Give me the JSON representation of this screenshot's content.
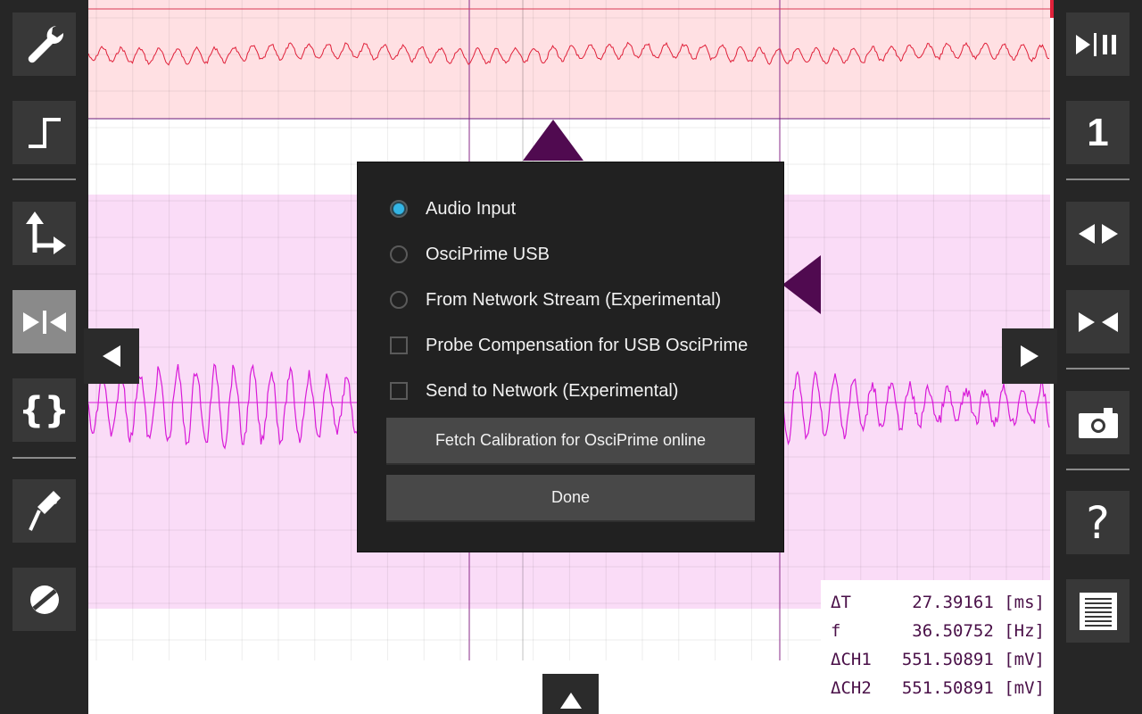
{
  "left_toolbar": {
    "buttons": [
      {
        "icon": "wrench-icon"
      },
      {
        "icon": "trigger-edge-icon"
      },
      {
        "icon": "axes-icon"
      },
      {
        "icon": "collapse-horizontal-icon",
        "active": true
      },
      {
        "icon": "braces-icon"
      },
      {
        "icon": "probe-icon"
      },
      {
        "icon": "disable-icon"
      }
    ]
  },
  "right_toolbar": {
    "run_pause_icon": "run-pause-icon",
    "channel_label": "1",
    "buttons": [
      {
        "icon": "expand-horizontal-icon"
      },
      {
        "icon": "collapse-horizontal-icon"
      },
      {
        "icon": "camera-icon"
      },
      {
        "icon": "help-icon"
      },
      {
        "icon": "menu-lines-icon"
      }
    ],
    "help_glyph": "?"
  },
  "dialog": {
    "options": [
      {
        "type": "radio",
        "label": "Audio Input",
        "checked": true
      },
      {
        "type": "radio",
        "label": "OsciPrime USB",
        "checked": false
      },
      {
        "type": "radio",
        "label": "From Network Stream (Experimental)",
        "checked": false
      },
      {
        "type": "checkbox",
        "label": "Probe Compensation for USB OsciPrime",
        "checked": false
      },
      {
        "type": "checkbox",
        "label": "Send to Network (Experimental)",
        "checked": false
      }
    ],
    "fetch_button": "Fetch Calibration for OsciPrime online",
    "done_button": "Done"
  },
  "measurements": [
    {
      "label": "ΔT",
      "value": "27.39161 [ms]"
    },
    {
      "label": "f",
      "value": "36.50752 [Hz]"
    },
    {
      "label": "ΔCH1",
      "value": "551.50891 [mV]"
    },
    {
      "label": "ΔCH2",
      "value": "551.50891 [mV]"
    }
  ],
  "colors": {
    "channel1": "#e0213a",
    "channel2": "#d81ad8",
    "marker": "#500a50",
    "accent": "#33b5e5"
  }
}
